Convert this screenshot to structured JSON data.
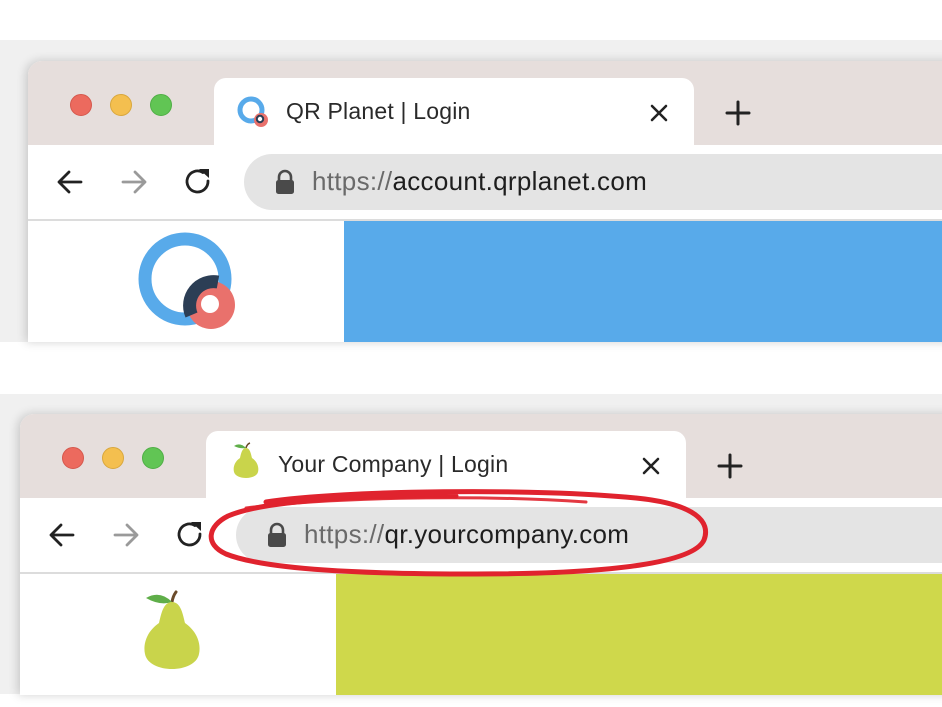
{
  "windows": [
    {
      "tab": {
        "title": "QR Planet | Login",
        "favicon": "qr-planet-logo-icon"
      },
      "omnibox": {
        "scheme": "https://",
        "host": "account.qrplanet.com"
      },
      "content": {
        "hero_color": "#58aaea",
        "logo": "qr-planet-logo-icon"
      }
    },
    {
      "tab": {
        "title": "Your Company | Login",
        "favicon": "pear-icon"
      },
      "omnibox": {
        "scheme": "https://",
        "host": "qr.yourcompany.com"
      },
      "content": {
        "hero_color": "#cfd84b",
        "logo": "pear-icon"
      },
      "annotation": {
        "shape": "hand-drawn-ellipse",
        "color": "#e0232e",
        "target": "omnibox"
      }
    }
  ],
  "colors": {
    "titlebar": "#e6dedc",
    "omnibox": "#e4e4e4",
    "close_light": "#ec6a5e",
    "minimize_light": "#f4bf4f",
    "zoom_light": "#61c554"
  }
}
